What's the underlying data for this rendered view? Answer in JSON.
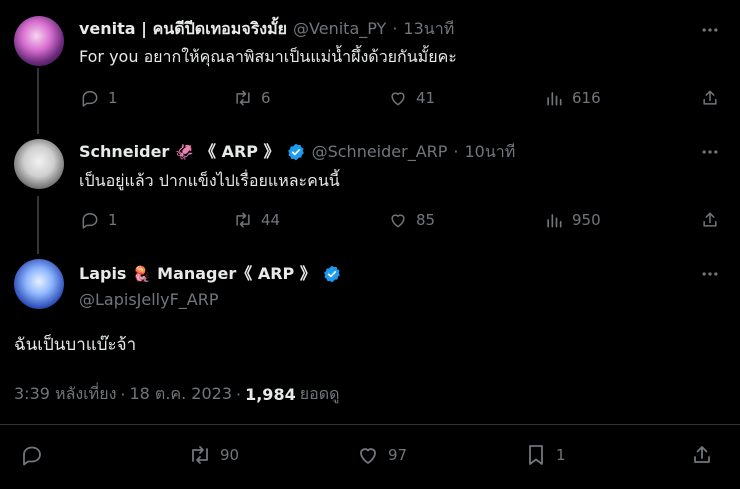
{
  "tweets": [
    {
      "name": "venita | คนดีปีดเทอมจริงมั้ย",
      "handle": "@Venita_PY",
      "time": "13นาที",
      "text": "For you อยากให้คุณลาพิสมาเป็นแม่น้ำผึ้งด้วยกันมั้ยคะ",
      "replies": "1",
      "retweets": "6",
      "likes": "41",
      "views": "616"
    },
    {
      "name": "Schneider",
      "name_suffix": "《 ARP 》",
      "handle": "@Schneider_ARP",
      "time": "10นาที",
      "text": "เป็นอยู่แล้ว ปากแข็งไปเรื่อยแหละคนนี้",
      "replies": "1",
      "retweets": "44",
      "likes": "85",
      "views": "950"
    }
  ],
  "main": {
    "name": "Lapis",
    "name_suffix": "Manager《 ARP 》",
    "handle": "@LapisJellyF_ARP",
    "text": "ฉันเป็นบาแบ๊ะจ้า",
    "time": "3:39 หลังเที่ยง",
    "date": "18 ต.ค. 2023",
    "views_count": "1,984",
    "views_label": "ยอดดู",
    "retweets": "90",
    "likes": "97",
    "bookmarks": "1"
  },
  "colors": {
    "background": "#000000",
    "text": "#e7e9ea",
    "muted": "#71767b",
    "verified": "#1d9bf0",
    "divider": "#2f3336"
  },
  "icons": [
    "reply-icon",
    "retweet-icon",
    "like-icon",
    "views-icon",
    "share-icon",
    "more-icon",
    "verified-icon",
    "bookmark-icon",
    "squid-emoji",
    "jellyfish-emoji"
  ]
}
